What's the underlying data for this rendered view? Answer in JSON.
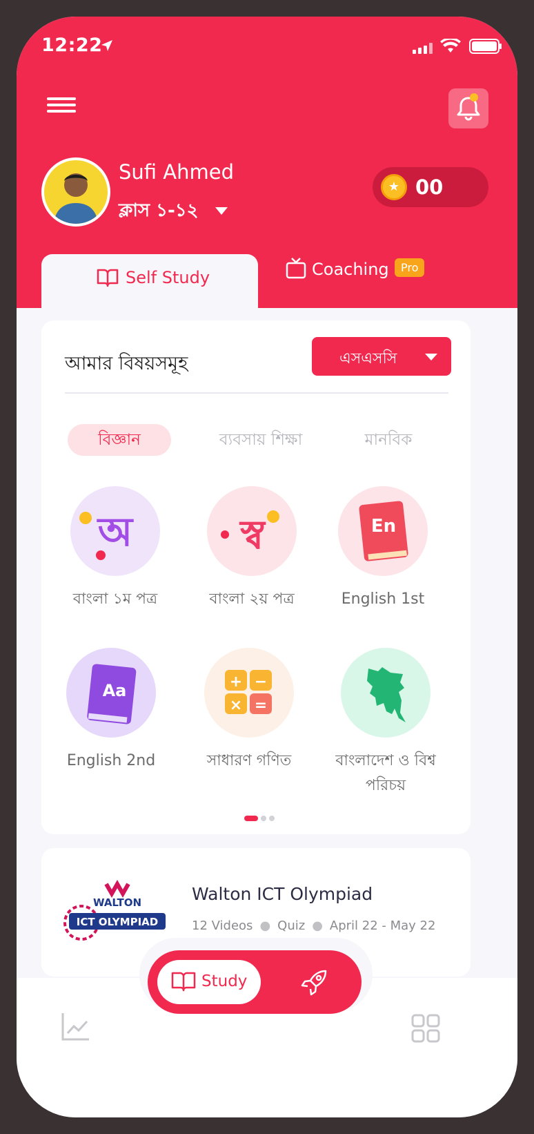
{
  "status_bar": {
    "time": "12:22"
  },
  "header": {
    "user_name": "Sufi Ahmed",
    "class_label": "ক্লাস ১-১২",
    "coins": "00"
  },
  "tabs": {
    "self_study": "Self Study",
    "coaching": "Coaching",
    "coaching_badge": "Pro"
  },
  "subjects_card": {
    "title": "আমার বিষয়সমূহ",
    "exam_selected": "এসএসসি",
    "groups": [
      "বিজ্ঞান",
      "ব্যবসায় শিক্ষা",
      "মানবিক"
    ],
    "active_group": "বিজ্ঞান",
    "subjects": [
      {
        "name": "বাংলা ১ম পত্র",
        "icon": "bangla-letter-icon"
      },
      {
        "name": "বাংলা ২য়  পত্র",
        "icon": "bangla-letter-icon"
      },
      {
        "name": "English 1st",
        "icon": "book-en-icon"
      },
      {
        "name": "English 2nd",
        "icon": "book-aa-icon"
      },
      {
        "name": "সাধারণ গণিত",
        "icon": "calculator-icon"
      },
      {
        "name": "বাংলাদেশ ও বিশ্ব পরিচয়",
        "icon": "bangladesh-map-icon"
      }
    ],
    "pagination": {
      "pages": 3,
      "current": 1
    }
  },
  "promo": {
    "logo_text_top": "WALTON",
    "logo_text_bottom": "ICT OLYMPIAD",
    "title": "Walton ICT Olympiad",
    "videos": "12 Videos",
    "quiz": "Quiz",
    "dates": "April 22 - May 22"
  },
  "bottom_nav": {
    "study_label": "Study"
  },
  "colors": {
    "primary": "#f2294f",
    "background": "#f6f6fb",
    "pro_badge": "#f9a51c"
  }
}
